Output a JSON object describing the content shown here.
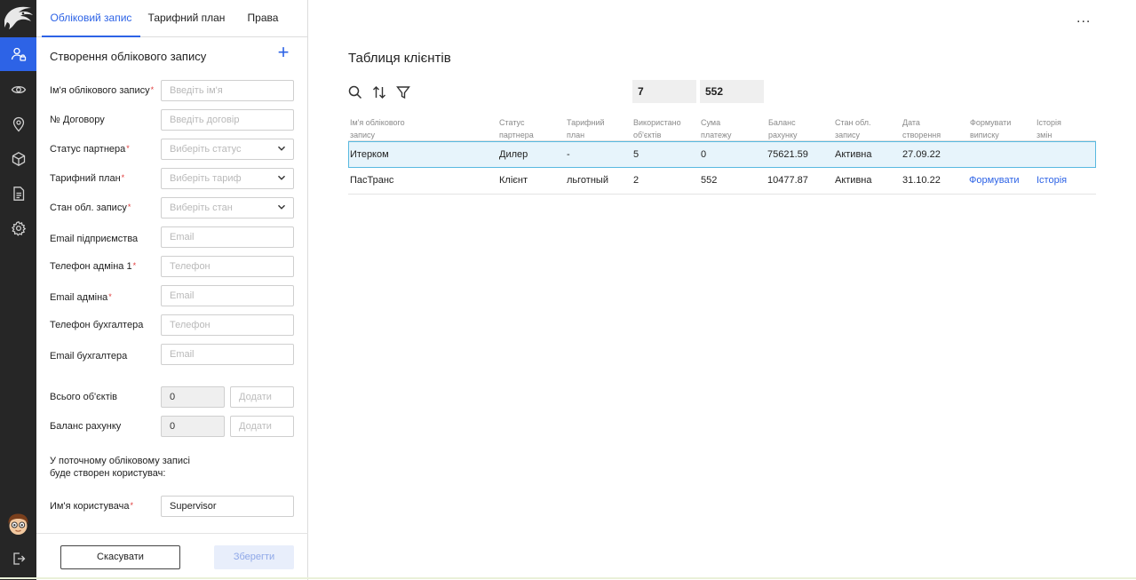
{
  "colors": {
    "accent": "#2d63e6",
    "rail": "#262626",
    "required": "#e03a3a",
    "selected_row": "#e7f4fb"
  },
  "rail": {
    "nav": [
      "user-accounts-icon",
      "eye-icon",
      "location-pin-icon",
      "cube-icon",
      "document-icon",
      "gear-icon"
    ],
    "bottom": [
      "avatar",
      "logout-icon"
    ]
  },
  "tabs": [
    {
      "label": "Обліковий запис",
      "active": true
    },
    {
      "label": "Тарифний план",
      "active": false
    },
    {
      "label": "Права",
      "active": false
    }
  ],
  "form": {
    "section_title": "Створення облікового запису",
    "fields": [
      {
        "label": "Ім'я облікового запису",
        "required": true,
        "placeholder": "Введіть ім'я",
        "type": "text"
      },
      {
        "label": "№ Договору",
        "required": false,
        "placeholder": "Введіть договір",
        "type": "text"
      },
      {
        "label": "Статус партнера",
        "required": true,
        "placeholder": "Виберіть статус",
        "type": "select"
      },
      {
        "label": "Тарифний план",
        "required": true,
        "placeholder": "Виберіть тариф",
        "type": "select"
      },
      {
        "label": "Стан обл. запису",
        "required": true,
        "placeholder": "Виберіть стан",
        "type": "select"
      },
      {
        "label": "Email підприємства",
        "required": false,
        "placeholder": "Email",
        "type": "text"
      },
      {
        "label": "Телефон адміна 1",
        "required": true,
        "placeholder": "Телефон",
        "type": "text"
      },
      {
        "label": "Email адміна",
        "required": true,
        "placeholder": "Email",
        "type": "text"
      },
      {
        "label": "Телефон бухгалтера",
        "required": false,
        "placeholder": "Телефон",
        "type": "text"
      },
      {
        "label": "Email бухгалтера",
        "required": false,
        "placeholder": "Email",
        "type": "text"
      }
    ],
    "objects": {
      "label": "Всього об'єктів",
      "value": "0",
      "add_placeholder": "Додати"
    },
    "balance": {
      "label": "Баланс рахунку",
      "value": "0",
      "add_placeholder": "Додати"
    },
    "note_line1": "У поточному обліковому записі",
    "note_line2": "буде створен користувач:",
    "username": {
      "label": "Им'я користувача",
      "required": true,
      "value": "Supervisor"
    },
    "cancel_label": "Скасувати",
    "save_label": "Зберегти"
  },
  "main": {
    "more_label": "...",
    "title": "Таблиця клієнтів",
    "toolbar": [
      "search-icon",
      "sort-icon",
      "filter-icon"
    ],
    "sum_objects": "7",
    "sum_payments": "552",
    "columns": [
      [
        "Ім'я облікового",
        "запису"
      ],
      [
        "Статус",
        "партнера"
      ],
      [
        "Тарифний",
        "план"
      ],
      [
        "Використано",
        "об'єктів"
      ],
      [
        "Сума",
        "платежу"
      ],
      [
        "Баланс",
        "рахунку"
      ],
      [
        "Стан обл.",
        "запису"
      ],
      [
        "Дата",
        "створення"
      ],
      [
        "Формувати",
        "виписку"
      ],
      [
        "Історія",
        "змін"
      ]
    ],
    "rows": [
      {
        "name": "Итерком",
        "status": "Дилер",
        "tariff": "-",
        "objects": "5",
        "payment": "0",
        "balance": "75621.59",
        "state": "Активна",
        "created": "27.09.22",
        "statement": "",
        "history": "",
        "selected": true
      },
      {
        "name": "ПасТранс",
        "status": "Клієнт",
        "tariff": "льготный",
        "objects": "2",
        "payment": "552",
        "balance": "10477.87",
        "state": "Активна",
        "created": "31.10.22",
        "statement": "Формувати",
        "history": "Історія",
        "selected": false
      }
    ]
  }
}
